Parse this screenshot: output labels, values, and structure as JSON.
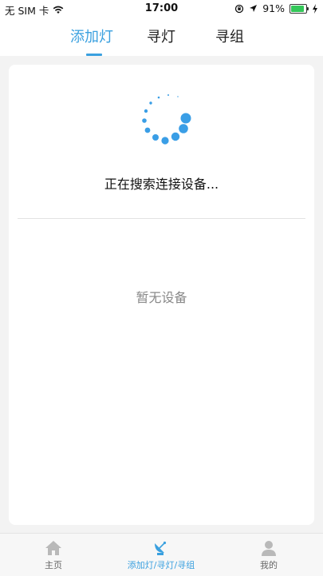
{
  "status_bar": {
    "carrier": "无 SIM 卡",
    "time": "17:00",
    "battery": "91%",
    "battery_level": 0.91,
    "icons": [
      "wifi-icon",
      "rotation-lock-icon",
      "location-icon",
      "battery-icon",
      "charging-icon"
    ]
  },
  "header": {
    "tabs": [
      {
        "label": "添加灯",
        "active": true
      },
      {
        "label": "寻灯",
        "active": false
      },
      {
        "label": "寻组",
        "active": false
      }
    ]
  },
  "main": {
    "searching_text": "正在搜索连接设备...",
    "empty_text": "暂无设备",
    "spinner_icon": "loading-spinner-icon"
  },
  "tabbar": {
    "items": [
      {
        "label": "主页",
        "icon": "home-icon",
        "active": false
      },
      {
        "label": "添加灯/寻灯/寻组",
        "icon": "satellite-dish-icon",
        "active": true
      },
      {
        "label": "我的",
        "icon": "user-icon",
        "active": false
      }
    ]
  },
  "colors": {
    "accent": "#3aa0df",
    "background": "#f3f3f3",
    "card": "#ffffff",
    "divider": "#e2e2e2",
    "muted_text": "#888888"
  }
}
